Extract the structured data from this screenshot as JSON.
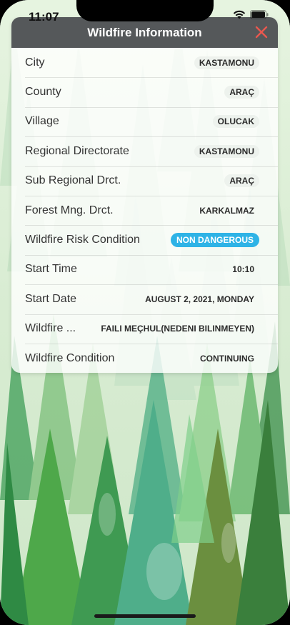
{
  "status_bar": {
    "time": "11:07",
    "wifi_icon": "wifi-icon",
    "battery_icon": "battery-icon"
  },
  "dialog": {
    "title": "Wildfire Information",
    "close_icon": "close-icon",
    "close_color": "#e8584f",
    "rows": [
      {
        "label": "City",
        "value": "KASTAMONU",
        "style": "pill"
      },
      {
        "label": "County",
        "value": "ARAÇ",
        "style": "pill"
      },
      {
        "label": "Village",
        "value": "OLUCAK",
        "style": "pill"
      },
      {
        "label": "Regional Directorate",
        "value": "KASTAMONU",
        "style": "pill"
      },
      {
        "label": "Sub Regional Drct.",
        "value": "ARAÇ",
        "style": "pill"
      },
      {
        "label": "Forest Mng. Drct.",
        "value": "KARKALMAZ",
        "style": "plain"
      },
      {
        "label": "Wildfire Risk Condition",
        "value": "NON DANGEROUS",
        "style": "info"
      },
      {
        "label": "Start Time",
        "value": "10:10",
        "style": "plain"
      },
      {
        "label": "Start Date",
        "value": "AUGUST 2, 2021, MONDAY",
        "style": "plain"
      },
      {
        "label": "Wildfire ...",
        "value": "FAILI MEÇHUL(NEDENI BILINMEYEN)",
        "style": "plain"
      },
      {
        "label": "Wildfire Condition",
        "value": "CONTINUING",
        "style": "plain"
      }
    ]
  },
  "colors": {
    "header_bg": "#55585a",
    "info_badge": "#2eb3e6",
    "forest_green": "#3d9a59"
  },
  "background": {
    "description_icon": "watercolor-forest-background"
  }
}
